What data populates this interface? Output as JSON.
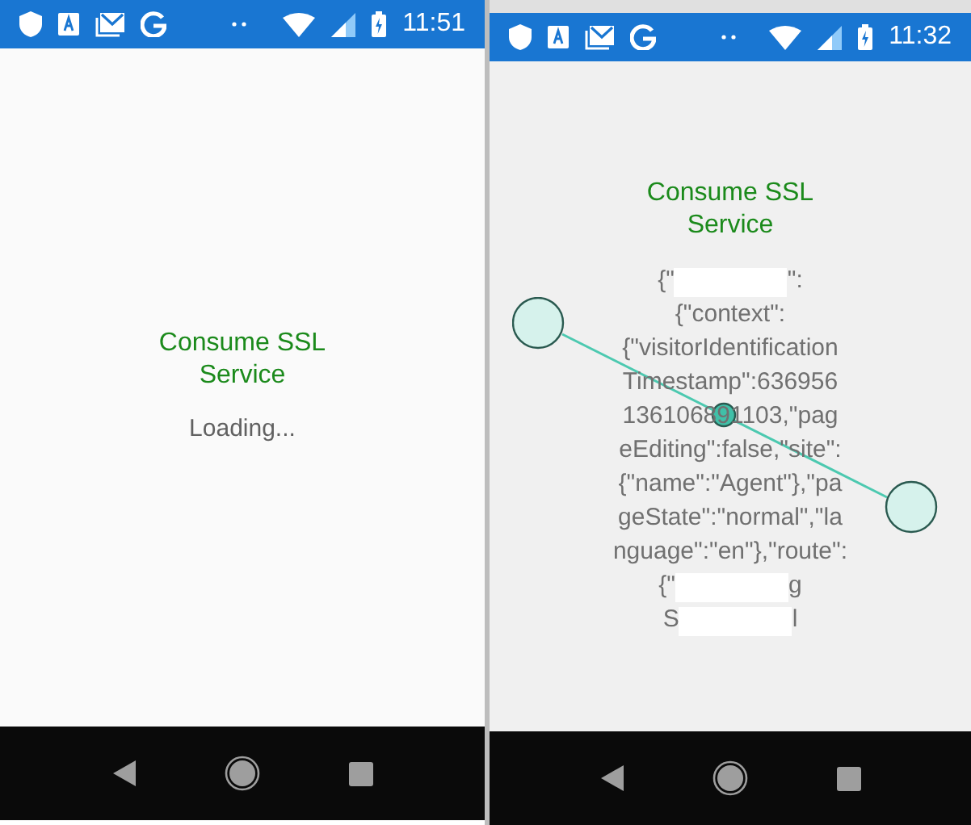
{
  "phones": [
    {
      "status_bar": {
        "time": "11:51"
      },
      "content": {
        "kind": "loading",
        "title": "Consume SSL Service",
        "message": "Loading..."
      }
    },
    {
      "status_bar": {
        "time": "11:32"
      },
      "content": {
        "kind": "response",
        "title": "Consume SSL Service",
        "lines": [
          [
            "{\"",
            "\":"
          ],
          [
            "{\"context\":"
          ],
          [
            "{\"visitorIdentification"
          ],
          [
            "Timestamp\":636956"
          ],
          [
            "136106891103,\"pag"
          ],
          [
            "eEditing\":false,\"site\":"
          ],
          [
            "{\"name\":\"Agent\"},\"pa"
          ],
          [
            "geState\":\"normal\",\"la"
          ],
          [
            "nguage\":\"en\"},\"route\":"
          ],
          [
            "{\"",
            "g"
          ],
          [
            "S",
            "l"
          ]
        ]
      }
    }
  ]
}
